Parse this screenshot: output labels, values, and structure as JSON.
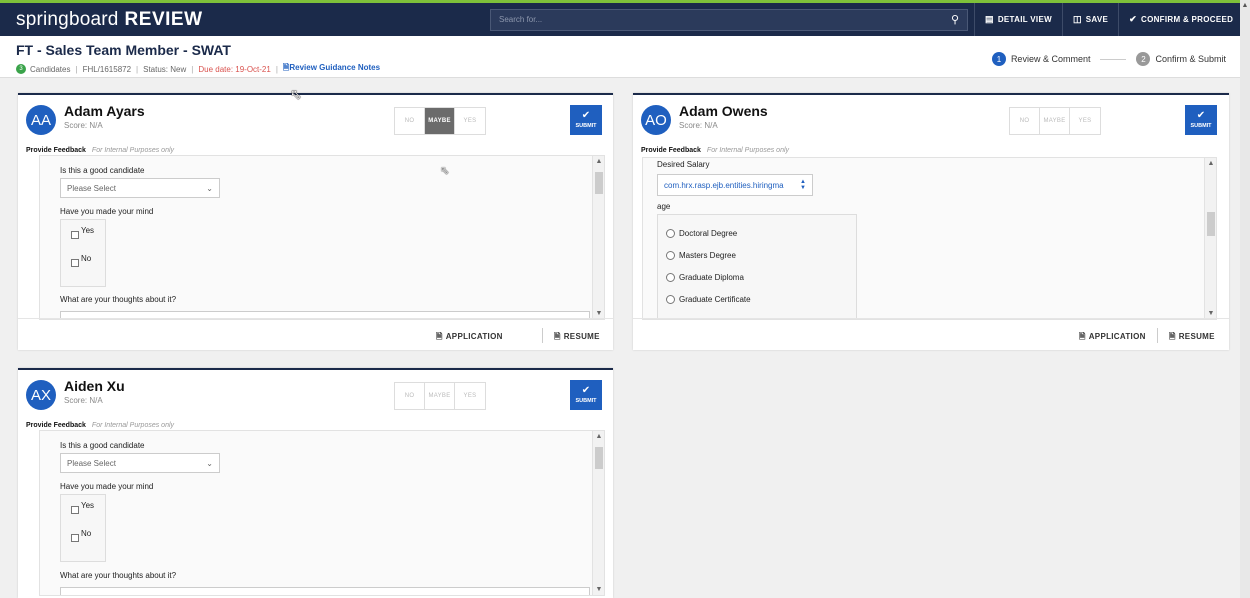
{
  "topbar": {
    "brand_part1": "springboard",
    "brand_part2": "REVIEW",
    "search_placeholder": "Search for...",
    "buttons": [
      {
        "label": "DETAIL VIEW",
        "icon": "detail-view-icon"
      },
      {
        "label": "SAVE",
        "icon": "save-icon"
      },
      {
        "label": "CONFIRM & PROCEED",
        "icon": "check-icon"
      }
    ]
  },
  "header": {
    "title": "FT - Sales Team Member - SWAT",
    "candidate_count": "3",
    "candidates_label": "Candidates",
    "job_id": "FHL/1615872",
    "status": "Status: New",
    "due_date": "Due date: 19-Oct-21",
    "guidance": "Review Guidance Notes",
    "steps": [
      {
        "num": "1",
        "label": "Review & Comment"
      },
      {
        "num": "2",
        "label": "Confirm & Submit"
      }
    ]
  },
  "choice_labels": {
    "no": "NO",
    "maybe": "MAYBE",
    "yes": "YES"
  },
  "submit_label": "SUBMIT",
  "feedback": {
    "title": "Provide Feedback",
    "note": "For Internal Purposes only"
  },
  "footer": {
    "application": "APPLICATION",
    "resume": "RESUME"
  },
  "cards": [
    {
      "initials": "AA",
      "name": "Adam Ayars",
      "score": "Score: N/A",
      "selected": "MAYBE",
      "q1": "Is this a good candidate",
      "select_value": "Please Select",
      "q2": "Have you made your mind",
      "opt_yes": "Yes",
      "opt_no": "No",
      "q3": "What are your thoughts about it?"
    },
    {
      "initials": "AO",
      "name": "Adam Owens",
      "score": "Score: N/A",
      "selected": "",
      "salary_label": "Desired Salary",
      "salary_value": "com.hrx.rasp.ejb.entities.hiringma",
      "age_label": "age",
      "radio_options": [
        "Doctoral Degree",
        "Masters Degree",
        "Graduate Diploma",
        "Graduate Certificate"
      ]
    },
    {
      "initials": "AX",
      "name": "Aiden Xu",
      "score": "Score: N/A",
      "selected": "",
      "q1": "Is this a good candidate",
      "select_value": "Please Select",
      "q2": "Have you made your mind",
      "opt_yes": "Yes",
      "opt_no": "No",
      "q3": "What are your thoughts about it?"
    }
  ],
  "colors": {
    "navy": "#1b2a4a",
    "accent_blue": "#1f5fbf",
    "green": "#7ec13a",
    "due_red": "#d9534f"
  }
}
